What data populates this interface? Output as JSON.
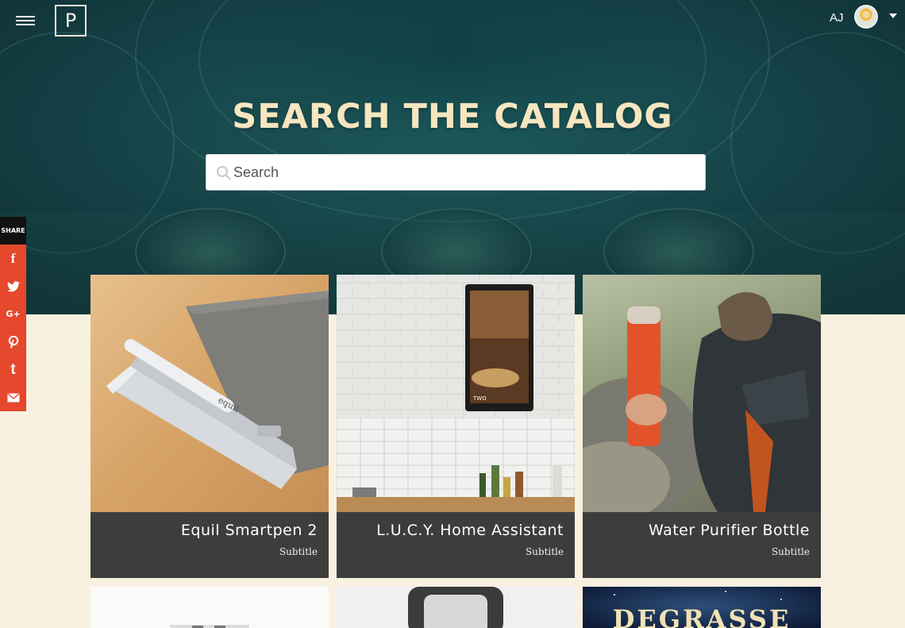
{
  "header": {
    "logo_letter": "P",
    "user_initials": "AJ"
  },
  "hero": {
    "title": "SEARCH THE CATALOG",
    "search_placeholder": "Search"
  },
  "share": {
    "label": "SHARE",
    "items": [
      {
        "name": "facebook",
        "glyph": "f"
      },
      {
        "name": "twitter",
        "glyph": "🐦"
      },
      {
        "name": "google-plus",
        "glyph": "G+"
      },
      {
        "name": "pinterest",
        "glyph": "P"
      },
      {
        "name": "tumblr",
        "glyph": "t"
      },
      {
        "name": "email",
        "glyph": "✉"
      }
    ]
  },
  "products": [
    {
      "title": "Equil Smartpen 2",
      "subtitle": "Subtitle"
    },
    {
      "title": "L.U.C.Y. Home Assistant",
      "subtitle": "Subtitle"
    },
    {
      "title": "Water Purifier Bottle",
      "subtitle": "Subtitle"
    }
  ],
  "next_row": {
    "third_card_text": "DEGRASSE"
  }
}
